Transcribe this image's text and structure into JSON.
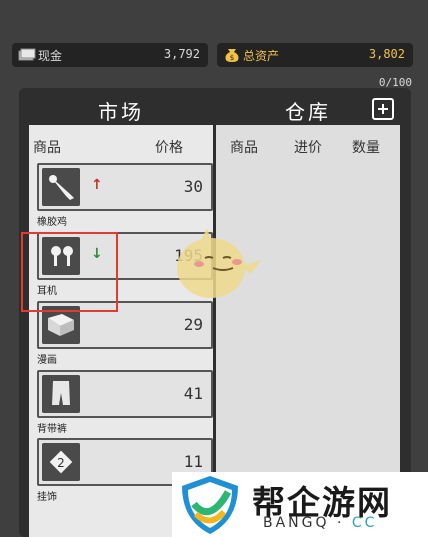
{
  "stats": {
    "cash_label": "现金",
    "cash_value": "3,792",
    "assets_label": "总资产",
    "assets_value": "3,802"
  },
  "capacity": "0/100",
  "tabs": {
    "market": "市场",
    "warehouse": "仓库"
  },
  "market_columns": {
    "item": "商品",
    "price": "价格"
  },
  "warehouse_columns": {
    "item": "商品",
    "cost": "进价",
    "qty": "数量"
  },
  "items": [
    {
      "name": "橡胶鸡",
      "price": "30",
      "trend": "up",
      "icon": "rubber-chicken-icon"
    },
    {
      "name": "耳机",
      "price": "195",
      "trend": "down",
      "icon": "earphones-icon"
    },
    {
      "name": "漫画",
      "price": "29",
      "trend": "",
      "icon": "comic-book-icon"
    },
    {
      "name": "背带裤",
      "price": "41",
      "trend": "",
      "icon": "overalls-icon"
    },
    {
      "name": "挂饰",
      "price": "11",
      "trend": "",
      "icon": "pendant-icon"
    }
  ],
  "colors": {
    "up": "#c0392b",
    "down": "#2e8b3a",
    "highlight": "#e13b32",
    "gold": "#f1c24a"
  },
  "watermark": {
    "title": "帮企游网",
    "sub_left": "BANGQ",
    "sub_right": "CC"
  }
}
